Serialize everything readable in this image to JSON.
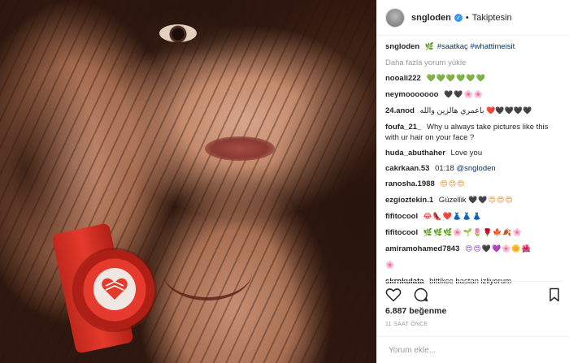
{
  "header": {
    "username": "sngloden",
    "verified_icon": "verified-badge-icon",
    "separator": "•",
    "follow_status": "Takiptesin"
  },
  "caption": {
    "username": "sngloden",
    "emoji": "🌿",
    "hashtags": "#saatkaç #whattimeisit"
  },
  "load_more": "Daha fazla yorum yükle",
  "comments": [
    {
      "user": "nooali222",
      "text": "",
      "emoji": "💚💚💚💚💚💚"
    },
    {
      "user": "neymooooooo",
      "text": "",
      "emoji": "🖤🖤🌸🌸"
    },
    {
      "user": "24.anod",
      "text": "باعمري هالزين والله",
      "emoji": "❤️🖤🖤🖤🖤"
    },
    {
      "user": "foufa_21_",
      "text": "Why u always take pictures like this with ur hair on your face ?",
      "emoji": ""
    },
    {
      "user": "huda_abuthaher",
      "text": "Love you",
      "emoji": ""
    },
    {
      "user": "cakrkaan.53",
      "text": "01:18",
      "mention": "@sngloden",
      "emoji": ""
    },
    {
      "user": "ranosha.1988",
      "text": "",
      "emoji": "😍😍😍"
    },
    {
      "user": "ezgioztekin.1",
      "text": "Güzellik",
      "emoji": "🖤🖤😍😍😍"
    },
    {
      "user": "fifitocool",
      "text": "",
      "emoji": "😂👠❤️👗👗👗"
    },
    {
      "user": "fifitocool",
      "text": "",
      "emoji": "🌿🌿🌿🌸🌱🌷🌹🍁🍂🌸"
    },
    {
      "user": "amiramohamed7843",
      "text": "",
      "emoji": "😍😍🖤💜🌸🌼🌺"
    },
    {
      "user": "",
      "text": "",
      "emoji": "🌸"
    },
    {
      "user": "skrnkulata",
      "text": "bittikce bastan izliyorum",
      "emoji": ""
    }
  ],
  "actions": {
    "like_icon": "heart-icon",
    "comment_icon": "comment-bubble-icon",
    "save_icon": "bookmark-icon"
  },
  "likes": "6.887 beğenme",
  "timestamp": "11 SAAT ÖNCE",
  "comment_box": {
    "placeholder": "Yorum ekle..."
  },
  "colors": {
    "link": "#003569",
    "verified": "#3897f0",
    "muted": "#999999",
    "watch": "#e33a2b"
  }
}
